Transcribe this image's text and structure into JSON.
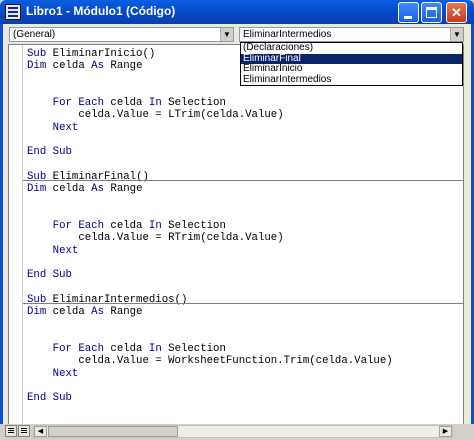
{
  "window": {
    "title": "Libro1 - Módulo1 (Código)",
    "min_glyph": "",
    "max_glyph": "",
    "close_glyph": "✕"
  },
  "toolbar": {
    "object_combo": "(General)",
    "procedure_combo": "EliminarIntermedios"
  },
  "dropdown": {
    "items": [
      "(Declaraciones)",
      "EliminarFinal",
      "EliminarInicio",
      "EliminarIntermedios"
    ],
    "selected": "EliminarFinal"
  },
  "code": {
    "lines": [
      "Sub EliminarInicio()",
      "Dim celda As Range",
      "",
      "",
      "    For Each celda In Selection",
      "        celda.Value = LTrim(celda.Value)",
      "    Next",
      "",
      "End Sub",
      "",
      "Sub EliminarFinal()",
      "Dim celda As Range",
      "",
      "",
      "    For Each celda In Selection",
      "        celda.Value = RTrim(celda.Value)",
      "    Next",
      "",
      "End Sub",
      "",
      "Sub EliminarIntermedios()",
      "Dim celda As Range",
      "",
      "",
      "    For Each celda In Selection",
      "        celda.Value = WorksheetFunction.Trim(celda.Value)",
      "    Next",
      "",
      "End Sub"
    ]
  },
  "colors": {
    "keyword": "#00008b",
    "text": "#000000",
    "titlebar": "#0548c8",
    "selection": "#0a246a"
  }
}
